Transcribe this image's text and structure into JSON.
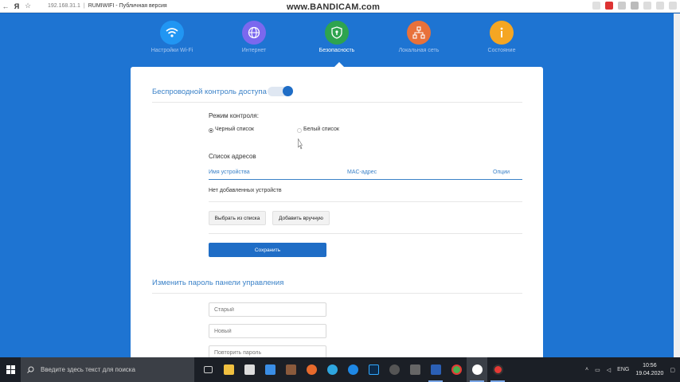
{
  "browser": {
    "url": "192.168.31.1",
    "title": "RUMIWIFI - Публичная версия",
    "watermark": "www.BANDICAM.com"
  },
  "nav": {
    "items": [
      {
        "label": "Настройки Wi-Fi",
        "color": "#2196f3",
        "icon": "wifi-icon"
      },
      {
        "label": "Интернет",
        "color": "#7b68ee",
        "icon": "globe-icon"
      },
      {
        "label": "Безопасность",
        "color": "#2ea44f",
        "icon": "shield-icon"
      },
      {
        "label": "Локальная сеть",
        "color": "#e8713a",
        "icon": "network-icon"
      },
      {
        "label": "Состояние",
        "color": "#f5a623",
        "icon": "info-icon"
      }
    ],
    "active_index": 2
  },
  "access_control": {
    "title": "Беспроводной контроль доступа",
    "toggle_on": true,
    "mode_label": "Режим контроля:",
    "blacklist_label": "Черный список",
    "whitelist_label": "Белый список",
    "selected_mode": "blacklist",
    "address_list_label": "Список адресов",
    "columns": {
      "device_name": "Имя устройства",
      "mac": "MAC-адрес",
      "options": "Опции"
    },
    "empty_text": "Нет добавленных устройств",
    "select_from_list": "Выбрать из списка",
    "add_manually": "Добавить вручную",
    "save": "Сохранить"
  },
  "password": {
    "title": "Изменить пароль панели управления",
    "old_placeholder": "Старый",
    "new_placeholder": "Новый",
    "repeat_placeholder": "Повторить пароль"
  },
  "taskbar": {
    "search_placeholder": "Введите здесь текст для поиска",
    "language": "ENG",
    "time": "10:56",
    "date": "19.04.2020"
  },
  "colors": {
    "page_bg": "#1e74d2",
    "accent": "#1f6dc6",
    "heading": "#3b82c8"
  }
}
